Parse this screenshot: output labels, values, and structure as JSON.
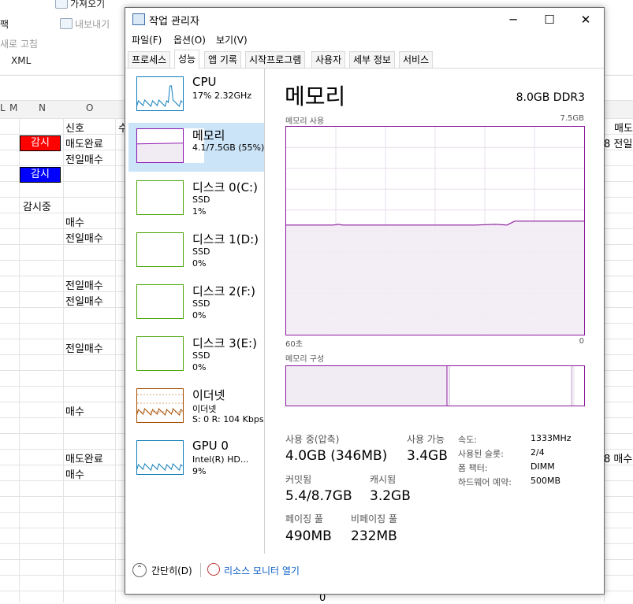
{
  "excel": {
    "ribbon": [
      {
        "text": "가져오기",
        "dim": false
      },
      {
        "text": "팩",
        "dim": false
      },
      {
        "text": "내보내기",
        "dim": true
      },
      {
        "text": "새로 고침",
        "dim": true
      },
      {
        "text": "XML",
        "dim": false
      }
    ],
    "col_headers": [
      "M",
      "N",
      "O"
    ],
    "left_col": "L",
    "cells": {
      "o1": "신호",
      "o1b": "수",
      "badge1": "감시",
      "o2": "매도완료",
      "o3": "전일매수",
      "badge2": "감시",
      "n5": "감시중",
      "o6": "매수",
      "o7": "전일매수",
      "o9": "전일매수",
      "o10": "전일매수",
      "o13": "전일매수",
      "o17": "매수",
      "o20": "매도완료",
      "o21": "매수",
      "r1": "매도",
      "r2": "8 전일",
      "r20": "8 매수",
      "bottom_zero": "0"
    },
    "badge1_color": "#ff0000",
    "badge2_color": "#0000ff"
  },
  "taskmgr": {
    "title": "작업 관리자",
    "window_controls": {
      "minimize": "─",
      "maximize": "☐",
      "close": "✕"
    },
    "menu": [
      "파일(F)",
      "옵션(O)",
      "보기(V)"
    ],
    "tabs": [
      {
        "label": "프로세스",
        "active": false
      },
      {
        "label": "성능",
        "active": true
      },
      {
        "label": "앱 기록",
        "active": false
      },
      {
        "label": "시작프로그램",
        "active": false
      },
      {
        "label": "사용자",
        "active": false
      },
      {
        "label": "세부 정보",
        "active": false
      },
      {
        "label": "서비스",
        "active": false
      }
    ],
    "sidebar": [
      {
        "name": "CPU",
        "line1": "17% 2.32GHz",
        "line2": "",
        "color": "#117dbb",
        "selected": false
      },
      {
        "name": "메모리",
        "line1": "4.1/7.5GB (55%)",
        "line2": "",
        "color": "#8b12ae",
        "selected": true
      },
      {
        "name": "디스크 0(C:)",
        "line1": "SSD",
        "line2": "1%",
        "color": "#4da60c",
        "selected": false
      },
      {
        "name": "디스크 1(D:)",
        "line1": "SSD",
        "line2": "0%",
        "color": "#4da60c",
        "selected": false
      },
      {
        "name": "디스크 2(F:)",
        "line1": "SSD",
        "line2": "0%",
        "color": "#4da60c",
        "selected": false
      },
      {
        "name": "디스크 3(E:)",
        "line1": "SSD",
        "line2": "0%",
        "color": "#4da60c",
        "selected": false
      },
      {
        "name": "이더넷",
        "line1": "이더넷",
        "line2": "S: 0 R: 104 Kbps",
        "color": "#a74f01",
        "selected": false
      },
      {
        "name": "GPU 0",
        "line1": "Intel(R) HD...",
        "line2": "9%",
        "color": "#117dbb",
        "selected": false
      }
    ],
    "main": {
      "title": "메모리",
      "type": "8.0GB DDR3",
      "usage_label": "메모리 사용",
      "usage_max": "7.5GB",
      "time_left": "60초",
      "time_right": "0",
      "composition_label": "메모리 구성",
      "usage_fraction": 0.55,
      "stats": {
        "in_use_label": "사용 중(압축)",
        "in_use_value": "4.0GB (346MB)",
        "available_label": "사용 가능",
        "available_value": "3.4GB",
        "committed_label": "커밋됨",
        "committed_value": "5.4/8.7GB",
        "cached_label": "캐시됨",
        "cached_value": "3.2GB",
        "paged_label": "페이징 풀",
        "paged_value": "490MB",
        "nonpaged_label": "비페이징 풀",
        "nonpaged_value": "232MB"
      },
      "details": [
        {
          "label": "속도:",
          "value": "1333MHz"
        },
        {
          "label": "사용된 슬롯:",
          "value": "2/4"
        },
        {
          "label": "폼 팩터:",
          "value": "DIMM"
        },
        {
          "label": "하드웨어 예약:",
          "value": "500MB"
        }
      ]
    },
    "footer": {
      "fewer_details": "간단히(D)",
      "resource_monitor": "리소스 모니터 열기"
    }
  }
}
